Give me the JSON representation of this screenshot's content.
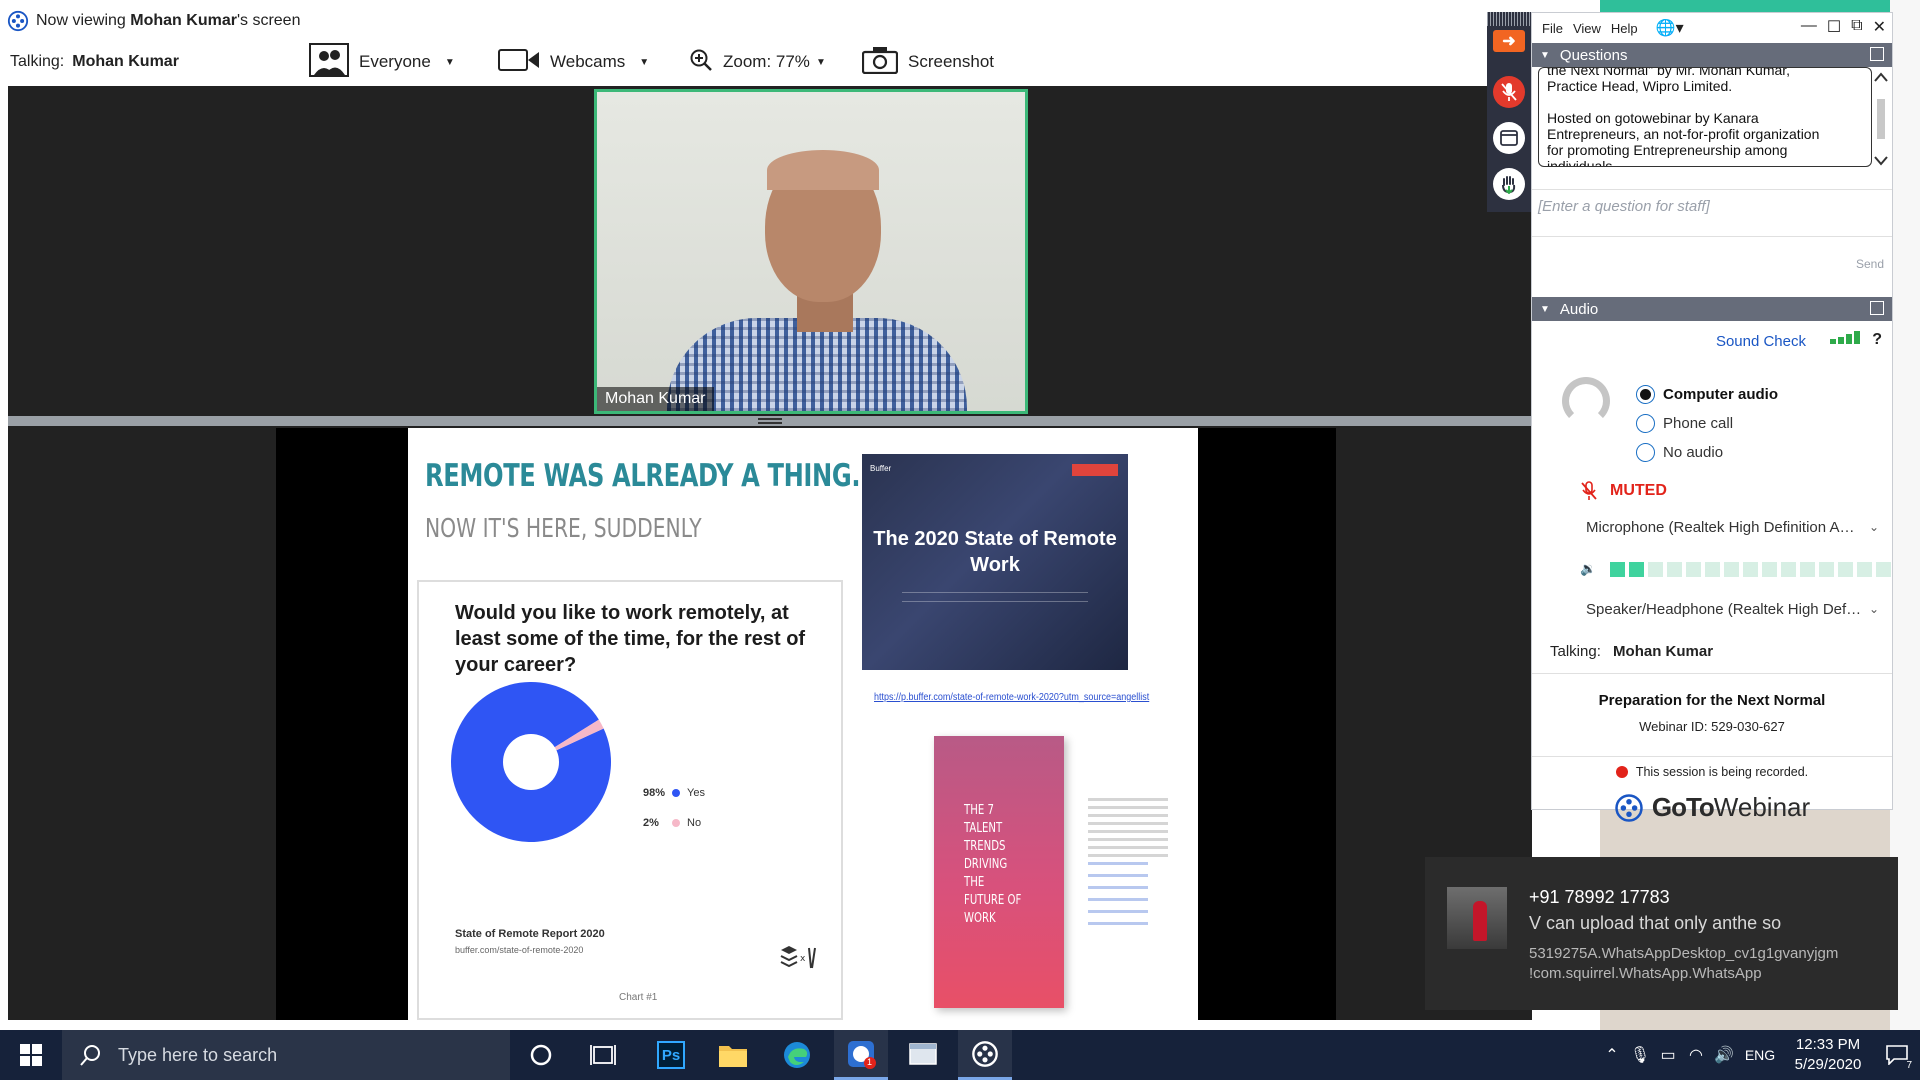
{
  "viewer": {
    "title_prefix": "Now viewing ",
    "presenter": "Mohan Kumar",
    "title_suffix": "'s screen",
    "talking_label": "Talking:",
    "talking_name": "Mohan Kumar",
    "toolbar": {
      "audience": "Everyone",
      "webcams": "Webcams",
      "zoom": "Zoom: 77%",
      "screenshot": "Screenshot"
    },
    "video_name": "Mohan Kumar"
  },
  "slide": {
    "title": "REMOTE WAS ALREADY A THING...",
    "subtitle": "NOW IT'S HERE, SUDDENLY",
    "survey_question": "Would you like to work remotely, at least some of the time, for the rest of your career?",
    "source_title": "State of Remote Report 2020",
    "source_url": "buffer.com/state-of-remote-2020",
    "chart_label": "Chart #1",
    "report_brand": "Buffer",
    "report_title": "The 2020 State of Remote Work",
    "report_link": "https://p.buffer.com/state-of-remote-work-2020?utm_source=angellist",
    "ebook_title": "THE 7 TALENT TRENDS DRIVING THE FUTURE OF WORK"
  },
  "chart_data": {
    "type": "pie",
    "categories": [
      "Yes",
      "No"
    ],
    "values": [
      98,
      2
    ],
    "value_labels": [
      "98%",
      "2%"
    ],
    "colors": [
      "#2f55f4",
      "#f6b8c8"
    ],
    "title": "Would you like to work remotely, at least some of the time, for the rest of your career?",
    "legend": "right"
  },
  "panel": {
    "menu": [
      "File",
      "View",
      "Help"
    ],
    "questions_header": "Questions",
    "question_log": [
      "the Next Normal\" by Mr. Mohan Kumar,",
      "Practice Head, Wipro Limited.",
      "",
      "Hosted on gotowebinar by Kanara",
      "Entrepreneurs, an not-for-profit organization",
      "for promoting Entrepreneurship among",
      "individuals."
    ],
    "question_placeholder": "[Enter a question for staff]",
    "send_label": "Send",
    "audio_header": "Audio",
    "sound_check": "Sound Check",
    "help": "?",
    "audio_options": [
      "Computer audio",
      "Phone call",
      "No audio"
    ],
    "selected_option": "Computer audio",
    "muted": "MUTED",
    "microphone": "Microphone (Realtek High Definition Audio)",
    "speaker": "Speaker/Headphone (Realtek High Definition Audio)",
    "mic_level": 0.13,
    "talking_label": "Talking:",
    "talking_name": "Mohan Kumar",
    "webinar_title": "Preparation for the Next Normal",
    "webinar_id": "Webinar ID: 529-030-627",
    "recording_notice": "This session is being recorded.",
    "brand_goto": "GoTo",
    "brand_webinar": "Webinar"
  },
  "toast": {
    "title": "+91 78992 17783",
    "message": "V can upload that only anthe so",
    "app_line1": "5319275A.WhatsAppDesktop_cv1g1gvanyjgm",
    "app_line2": "!com.squirrel.WhatsApp.WhatsApp"
  },
  "taskbar": {
    "search_placeholder": "Type here to search",
    "language": "ENG",
    "time": "12:33 PM",
    "date": "5/29/2020",
    "notification_count": "7",
    "badge_count": "1",
    "photoshop_label": "Ps"
  },
  "colors": {
    "accent_green": "#3cb878",
    "muted_red": "#e2231a",
    "link_blue": "#1a56c4",
    "slide_title": "#2b8a98",
    "taskbar": "#16223a"
  }
}
